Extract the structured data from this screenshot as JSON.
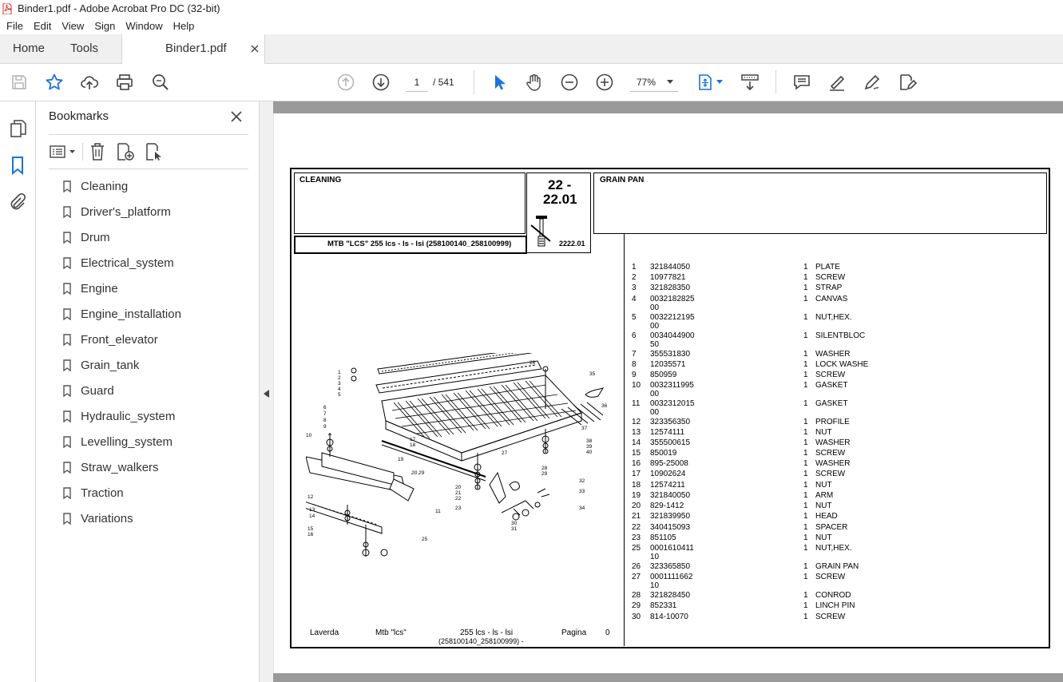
{
  "window": {
    "title": "Binder1.pdf - Adobe Acrobat Pro DC (32-bit)"
  },
  "menu": [
    "File",
    "Edit",
    "View",
    "Sign",
    "Window",
    "Help"
  ],
  "tabs": {
    "home": "Home",
    "tools": "Tools",
    "document": "Binder1.pdf"
  },
  "toolbar": {
    "page_current": "1",
    "page_total": "/ 541",
    "zoom": "77%"
  },
  "bookmarks": {
    "title": "Bookmarks",
    "items": [
      "Cleaning",
      "Driver's_platform",
      "Drum",
      "Electrical_system",
      "Engine",
      "Engine_installation",
      "Front_elevator",
      "Grain_tank",
      "Guard",
      "Hydraulic_system",
      "Levelling_system",
      "Straw_walkers",
      "Traction",
      "Variations"
    ]
  },
  "pdf": {
    "section": "CLEANING",
    "code_top": "22 -",
    "code_bottom": "22.01",
    "group_title": "GRAIN PAN",
    "model_line": "MTB \"LCS\" 255 lcs - ls - lsi (258100140_258100999)",
    "figure_no": "2222.01",
    "footer": {
      "brand": "Laverda",
      "model": "Mtb \"lcs\"",
      "variant": "255 lcs - ls - lsi",
      "range": "(258100140_258100999) -",
      "page_label": "Pagina",
      "page_no": "0"
    },
    "parts": [
      {
        "n": "1",
        "code": "321844050",
        "code2": "",
        "qty": "1",
        "desc": "PLATE"
      },
      {
        "n": "2",
        "code": "10977821",
        "code2": "",
        "qty": "1",
        "desc": "SCREW"
      },
      {
        "n": "3",
        "code": "321828350",
        "code2": "",
        "qty": "1",
        "desc": "STRAP"
      },
      {
        "n": "4",
        "code": "0032182825",
        "code2": "00",
        "qty": "1",
        "desc": "CANVAS"
      },
      {
        "n": "5",
        "code": "0032212195",
        "code2": "00",
        "qty": "1",
        "desc": "NUT,HEX."
      },
      {
        "n": "6",
        "code": "0034044900",
        "code2": "50",
        "qty": "1",
        "desc": "SILENTBLOC"
      },
      {
        "n": "7",
        "code": "355531830",
        "code2": "",
        "qty": "1",
        "desc": "WASHER"
      },
      {
        "n": "8",
        "code": "12035571",
        "code2": "",
        "qty": "1",
        "desc": "LOCK WASHE"
      },
      {
        "n": "9",
        "code": "850959",
        "code2": "",
        "qty": "1",
        "desc": "SCREW"
      },
      {
        "n": "10",
        "code": "0032311995",
        "code2": "00",
        "qty": "1",
        "desc": "GASKET"
      },
      {
        "n": "11",
        "code": "0032312015",
        "code2": "00",
        "qty": "1",
        "desc": "GASKET"
      },
      {
        "n": "12",
        "code": "323356350",
        "code2": "",
        "qty": "1",
        "desc": "PROFILE"
      },
      {
        "n": "13",
        "code": "12574111",
        "code2": "",
        "qty": "1",
        "desc": "NUT"
      },
      {
        "n": "14",
        "code": "355500615",
        "code2": "",
        "qty": "1",
        "desc": "WASHER"
      },
      {
        "n": "15",
        "code": "850019",
        "code2": "",
        "qty": "1",
        "desc": "SCREW"
      },
      {
        "n": "16",
        "code": "895-25008",
        "code2": "",
        "qty": "1",
        "desc": "WASHER"
      },
      {
        "n": "17",
        "code": "10902624",
        "code2": "",
        "qty": "1",
        "desc": "SCREW"
      },
      {
        "n": "18",
        "code": "12574211",
        "code2": "",
        "qty": "1",
        "desc": "NUT"
      },
      {
        "n": "19",
        "code": "321840050",
        "code2": "",
        "qty": "1",
        "desc": "ARM"
      },
      {
        "n": "20",
        "code": "829-1412",
        "code2": "",
        "qty": "1",
        "desc": "NUT"
      },
      {
        "n": "21",
        "code": "321839950",
        "code2": "",
        "qty": "1",
        "desc": "HEAD"
      },
      {
        "n": "22",
        "code": "340415093",
        "code2": "",
        "qty": "1",
        "desc": "SPACER"
      },
      {
        "n": "23",
        "code": "851105",
        "code2": "",
        "qty": "1",
        "desc": "NUT"
      },
      {
        "n": "25",
        "code": "0001610411",
        "code2": "10",
        "qty": "1",
        "desc": "NUT,HEX."
      },
      {
        "n": "26",
        "code": "323365850",
        "code2": "",
        "qty": "1",
        "desc": "GRAIN PAN"
      },
      {
        "n": "27",
        "code": "0001111662",
        "code2": "10",
        "qty": "1",
        "desc": "SCREW"
      },
      {
        "n": "28",
        "code": "321828450",
        "code2": "",
        "qty": "1",
        "desc": "CONROD"
      },
      {
        "n": "29",
        "code": "852331",
        "code2": "",
        "qty": "1",
        "desc": "LINCH PIN"
      },
      {
        "n": "30",
        "code": "814-10070",
        "code2": "",
        "qty": "1",
        "desc": "SCREW"
      }
    ],
    "callouts": [
      "1",
      "2",
      "3",
      "4",
      "5",
      "6",
      "7",
      "8",
      "9",
      "10",
      "11",
      "12",
      "13",
      "14",
      "15",
      "16",
      "17",
      "18",
      "19",
      "20",
      "21",
      "22",
      "23",
      "25",
      "26",
      "27",
      "28",
      "29",
      "30",
      "31",
      "32",
      "33",
      "34",
      "35",
      "36",
      "37",
      "38",
      "39",
      "40"
    ],
    "dim_label": "20.29"
  },
  "colors": {
    "accent": "#1473e6",
    "acrobat_red": "#e02a20"
  }
}
